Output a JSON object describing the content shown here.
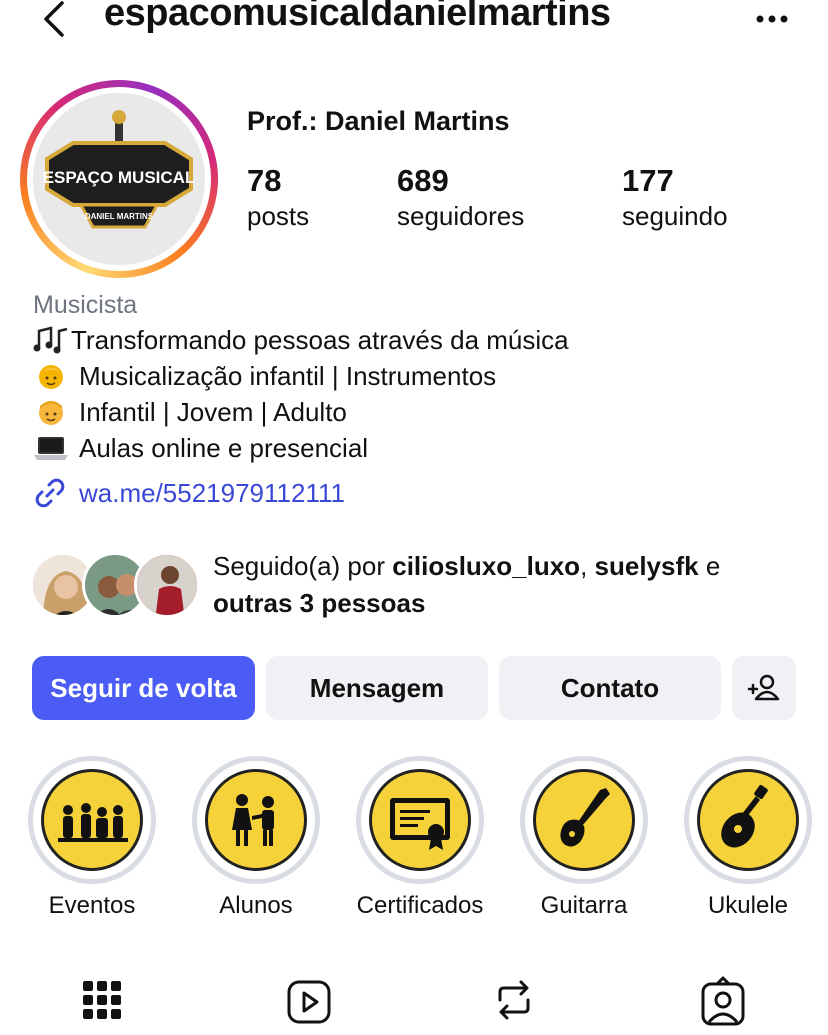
{
  "header": {
    "username": "espacomusicaldanielmartins",
    "back_icon": "back-chevron-icon",
    "more_icon": "more-horizontal-icon"
  },
  "profile": {
    "display_name": "Prof.: Daniel Martins",
    "avatar_logo_text": "ESPAÇO MUSICAL",
    "avatar_logo_subtext": "DANIEL MARTINS",
    "stats": [
      {
        "value": "78",
        "label": "posts"
      },
      {
        "value": "689",
        "label": "seguidores"
      },
      {
        "value": "177",
        "label": "seguindo"
      }
    ]
  },
  "bio": {
    "category": "Musicista",
    "lines": [
      {
        "emoji": "music-notes",
        "text": "Transformando pessoas através da música"
      },
      {
        "emoji": "girl-face",
        "text": "Musicalização infantil | Instrumentos"
      },
      {
        "emoji": "boy-face",
        "text": "Infantil | Jovem | Adulto"
      },
      {
        "emoji": "laptop",
        "text": "Aulas online e presencial"
      }
    ],
    "link": "wa.me/5521979112111"
  },
  "followed_by": {
    "prefix": "Seguido(a) por ",
    "user1": "ciliosluxo_luxo",
    "separator": ", ",
    "user2": "suelysfk",
    "conjunction": " e",
    "others": "outras 3 pessoas"
  },
  "actions": {
    "follow_back": "Seguir de volta",
    "message": "Mensagem",
    "contact": "Contato"
  },
  "highlights": [
    {
      "label": "Eventos",
      "icon": "band-silhouette-icon"
    },
    {
      "label": "Alunos",
      "icon": "students-icon"
    },
    {
      "label": "Certificados",
      "icon": "certificate-icon"
    },
    {
      "label": "Guitarra",
      "icon": "electric-guitar-icon"
    },
    {
      "label": "Ukulele",
      "icon": "ukulele-icon"
    }
  ],
  "tabs": [
    "grid-icon",
    "reels-icon",
    "reposts-icon",
    "tagged-icon"
  ],
  "colors": {
    "primary_button": "#4a5cf5",
    "secondary_button": "#eff1f4",
    "link": "#3b48d6",
    "highlight_fill": "#f5d23a"
  }
}
